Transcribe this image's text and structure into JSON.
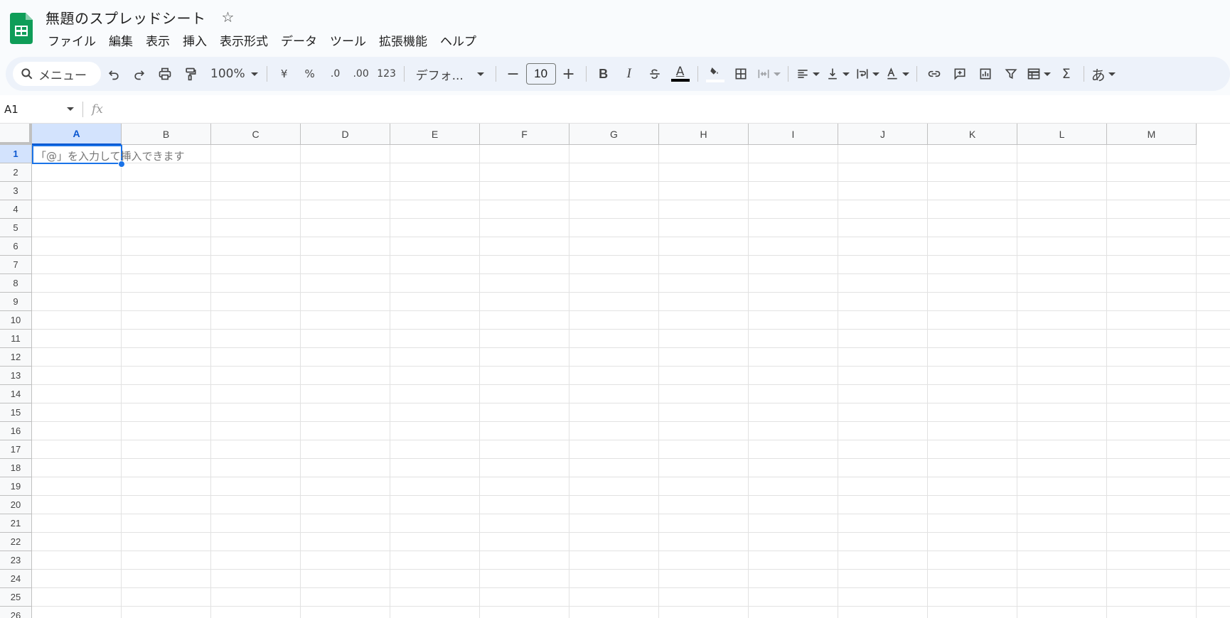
{
  "app": {
    "title": "無題のスプレッドシート",
    "menu": [
      "ファイル",
      "編集",
      "表示",
      "挿入",
      "表示形式",
      "データ",
      "ツール",
      "拡張機能",
      "ヘルプ"
    ]
  },
  "toolbar": {
    "search_label": "メニュー",
    "zoom": "100%",
    "currency": "¥",
    "percent": "%",
    "dec_decrease": ".0",
    "dec_increase": ".00",
    "more_formats": "123",
    "font": "デフォ...",
    "font_size": "10",
    "bold": "B",
    "italic": "I",
    "text_color_label": "A",
    "ime": "あ",
    "accent_color": "#1a73e8"
  },
  "formula_bar": {
    "name_box": "A1",
    "fx": "fx"
  },
  "grid": {
    "columns": [
      "A",
      "B",
      "C",
      "D",
      "E",
      "F",
      "G",
      "H",
      "I",
      "J",
      "K",
      "L",
      "M"
    ],
    "rows": [
      "1",
      "2",
      "3",
      "4",
      "5",
      "6",
      "7",
      "8",
      "9",
      "10",
      "11",
      "12",
      "13",
      "14",
      "15",
      "16",
      "17",
      "18",
      "19",
      "20",
      "21",
      "22",
      "23",
      "24",
      "25",
      "26"
    ],
    "selected_cell": "A1",
    "a1_placeholder": "「@」を入力して挿入できます"
  }
}
